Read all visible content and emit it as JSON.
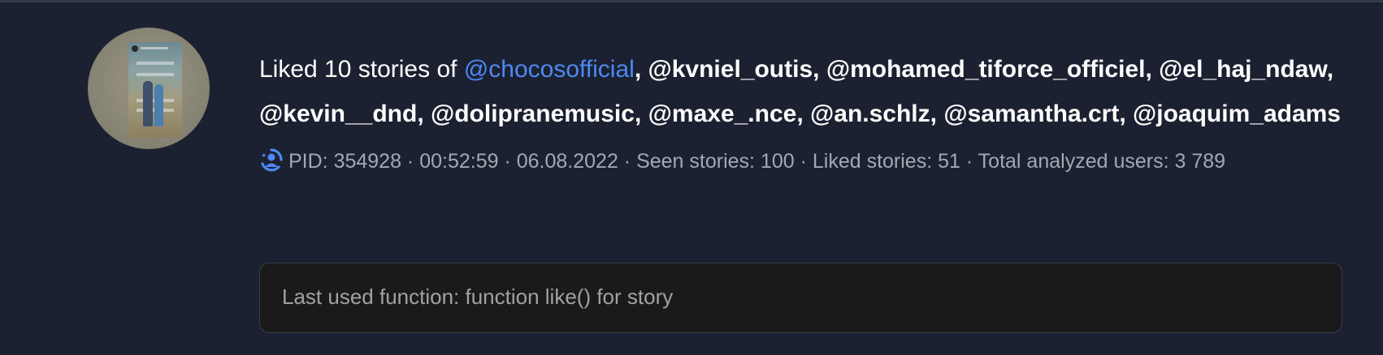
{
  "activity": {
    "headline_prefix": "Liked 10 stories of ",
    "first_user": "@chocosofficial",
    "users": [
      "@kvniel_outis",
      "@mohamed_tiforce_officiel",
      "@el_haj_ndaw",
      "@kevin__dnd",
      "@dolipranemusic",
      "@maxe_.nce",
      "@an.schlz",
      "@samantha.crt",
      "@joaquim_adams"
    ],
    "separator": ", ",
    "status_icon": "loading-spinner-icon",
    "meta_text": "PID: 354928 · 00:52:59 · 06.08.2022 · Seen stories: 100 · Liked stories: 51 · Total analyzed users: 3 789",
    "last_function": "Last used function: function like() for story",
    "avatar_icon": "story-thumbnail-avatar"
  },
  "colors": {
    "background": "#1b2130",
    "link": "#4e88f5",
    "text": "#ffffff",
    "meta": "#a3a8b2",
    "box_bg": "#1a1a1a",
    "box_text": "#a2a2a2"
  }
}
